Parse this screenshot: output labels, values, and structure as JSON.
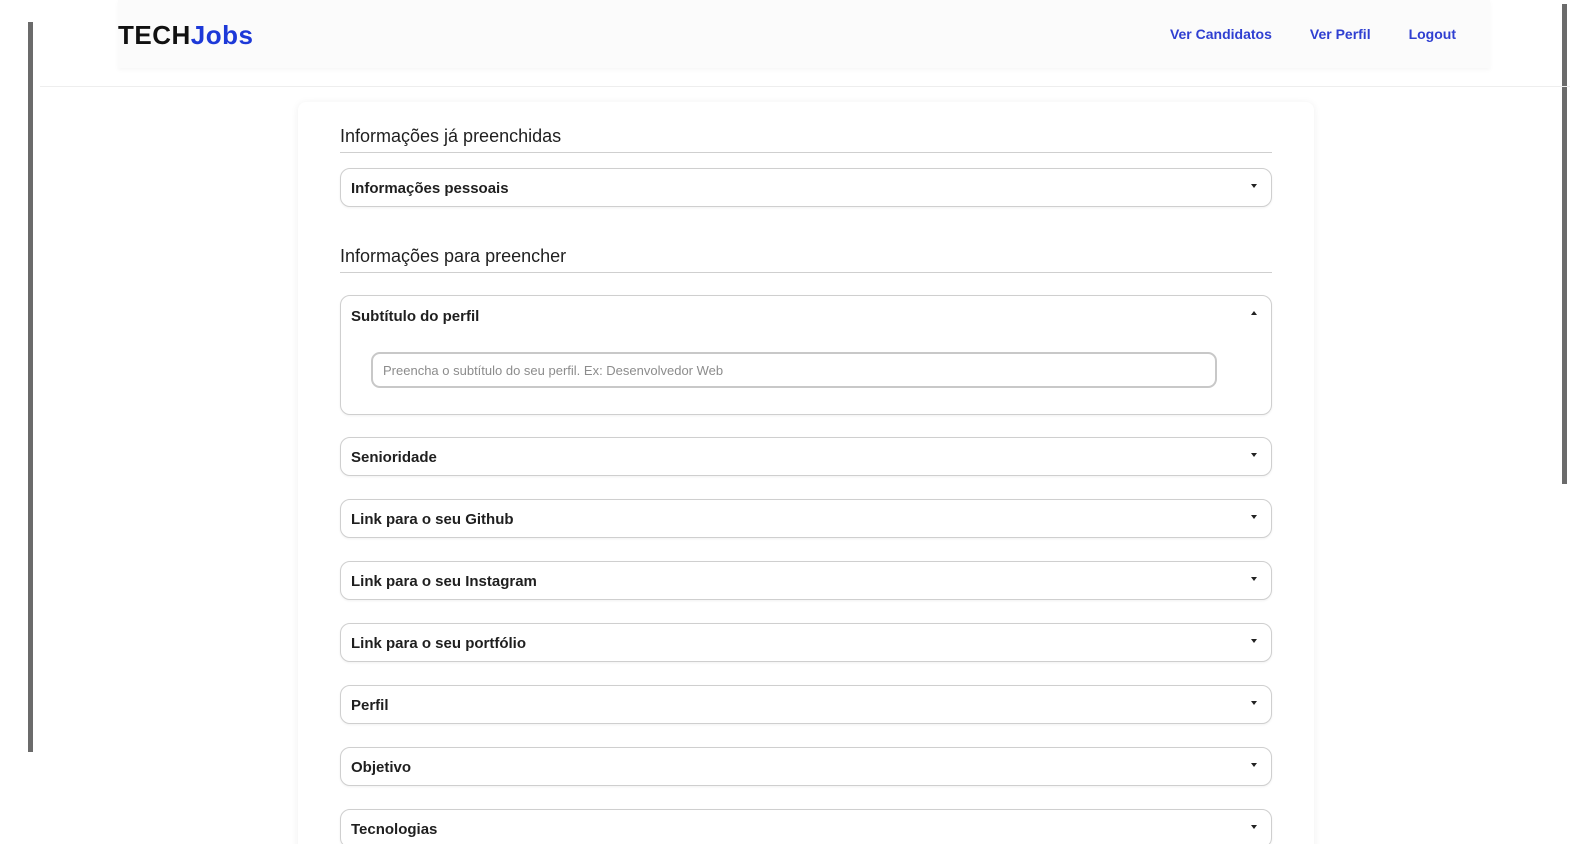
{
  "brand": {
    "tech": "TECH",
    "jobs": "Jobs",
    "tech_color": "#111111",
    "jobs_color": "#1d39d8"
  },
  "nav": {
    "links": [
      "Ver Candidatos",
      "Ver Perfil",
      "Logout"
    ],
    "link_color": "#2f3fd1"
  },
  "sections": {
    "filled_title": "Informações já preenchidas",
    "to_fill_title": "Informações para preencher"
  },
  "filled_items": [
    {
      "label": "Informações pessoais",
      "icon": "chevron-down-icon"
    }
  ],
  "to_fill_items": [
    {
      "label": "Subtítulo do perfil",
      "icon": "chevron-up-icon",
      "expanded": true,
      "input_placeholder": "Preencha o subtítulo do seu perfil. Ex: Desenvolvedor Web",
      "input_value": ""
    },
    {
      "label": "Senioridade",
      "icon": "chevron-down-icon"
    },
    {
      "label": "Link para o seu Github",
      "icon": "chevron-down-icon"
    },
    {
      "label": "Link para o seu Instagram",
      "icon": "chevron-down-icon"
    },
    {
      "label": "Link para o seu portfólio",
      "icon": "chevron-down-icon"
    },
    {
      "label": "Perfil",
      "icon": "chevron-down-icon"
    },
    {
      "label": "Objetivo",
      "icon": "chevron-down-icon"
    },
    {
      "label": "Tecnologias",
      "icon": "chevron-down-icon"
    }
  ]
}
